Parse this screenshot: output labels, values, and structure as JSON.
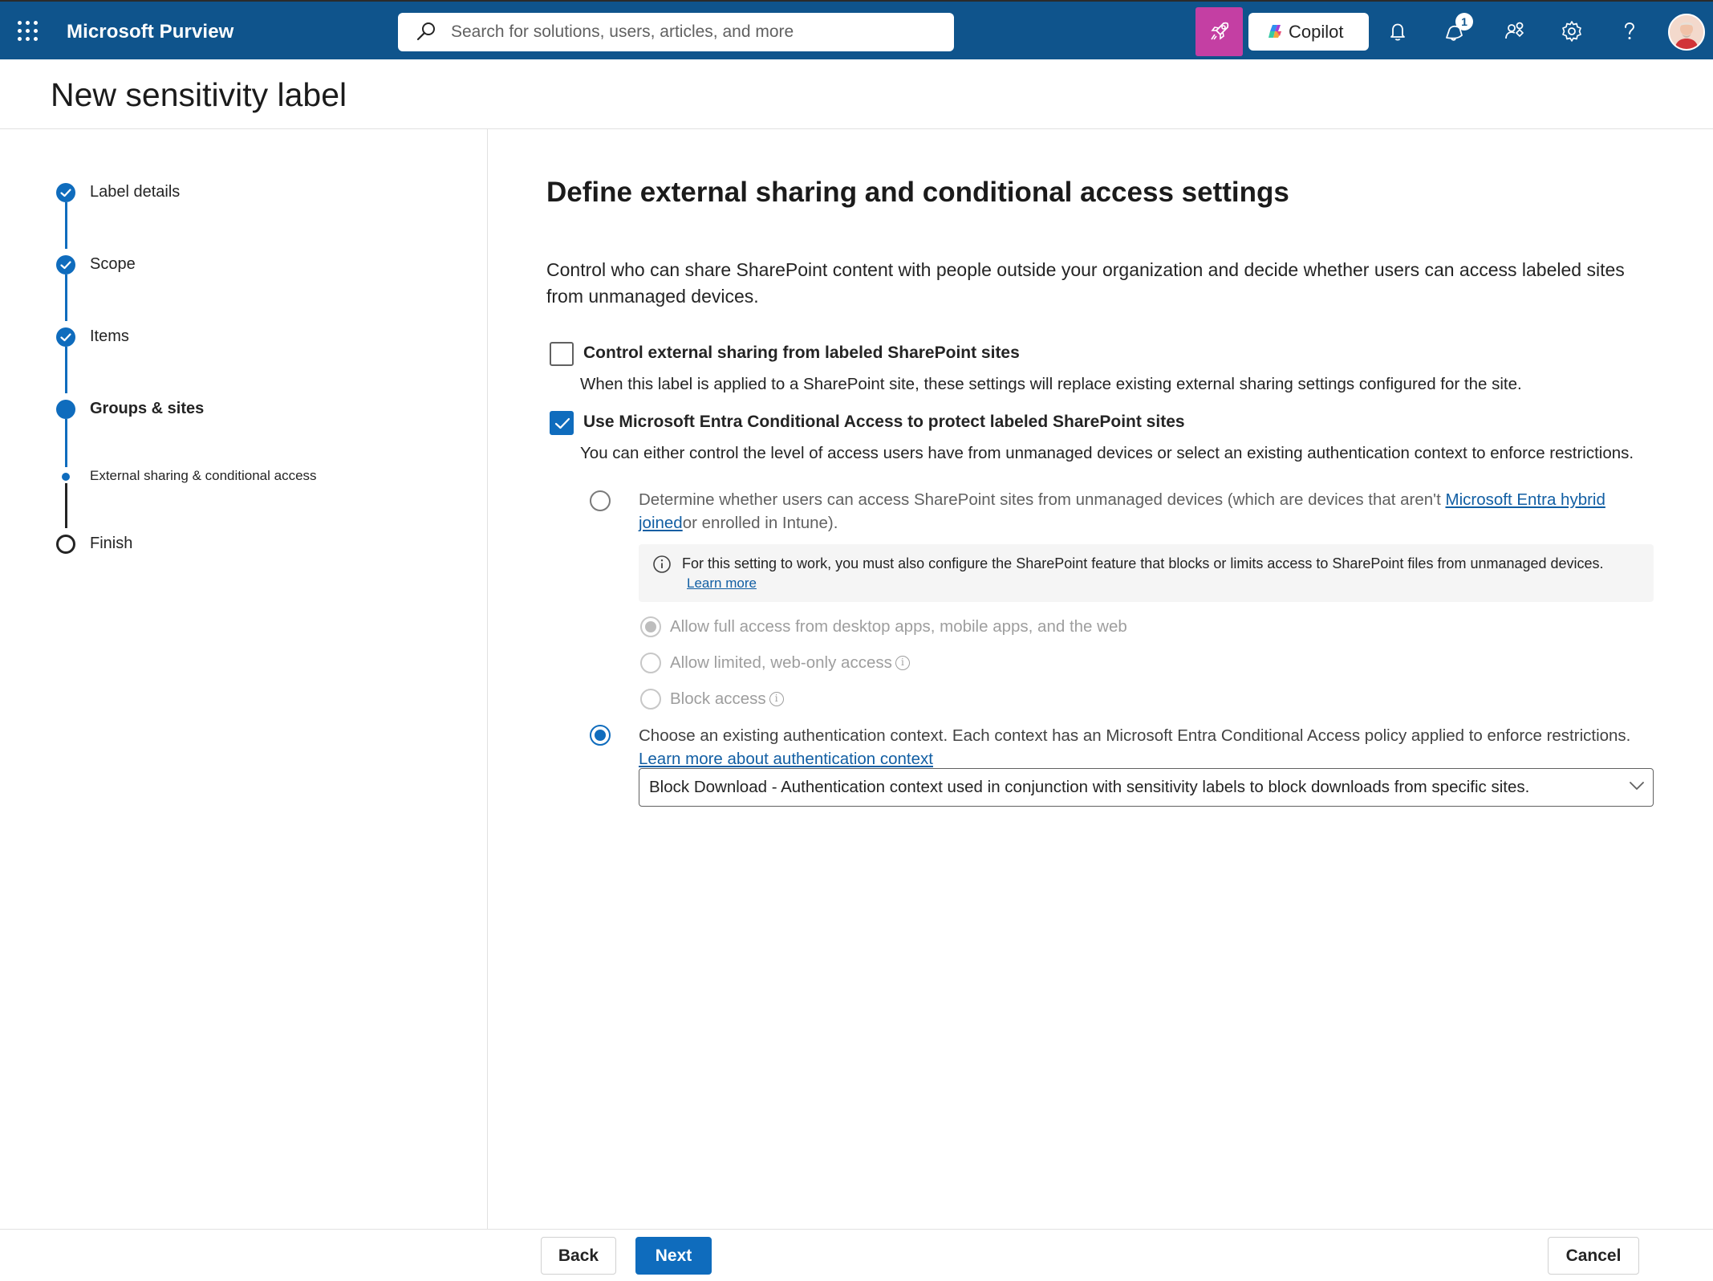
{
  "topbar": {
    "app_name": "Microsoft Purview",
    "search_placeholder": "Search for solutions, users, articles, and more",
    "copilot_label": "Copilot",
    "notification_count": "1"
  },
  "page": {
    "title": "New sensitivity label"
  },
  "stepper": {
    "steps": [
      {
        "label": "Label details",
        "state": "done"
      },
      {
        "label": "Scope",
        "state": "done"
      },
      {
        "label": "Items",
        "state": "done"
      },
      {
        "label": "Groups & sites",
        "state": "current"
      },
      {
        "label": "External sharing & conditional access",
        "state": "current-substep"
      },
      {
        "label": "Finish",
        "state": "todo"
      }
    ]
  },
  "main": {
    "heading": "Define external sharing and conditional access settings",
    "intro": "Control who can share SharePoint content with people outside your organization and decide whether users can access labeled sites from unmanaged devices.",
    "external_sharing": {
      "label": "Control external sharing from labeled SharePoint sites",
      "description": "When this label is applied to a SharePoint site, these settings will replace existing external sharing settings configured for the site.",
      "checked": false
    },
    "conditional_access": {
      "label": "Use Microsoft Entra Conditional Access to protect labeled SharePoint sites",
      "description": "You can either control the level of access users have from unmanaged devices or select an existing authentication context to enforce restrictions.",
      "checked": true
    },
    "option_unmanaged": {
      "text_before": "Determine whether users can access SharePoint sites from unmanaged devices (which are devices that aren't ",
      "link": "Microsoft Entra hybrid joined",
      "text_after": "or enrolled in Intune).",
      "info_text": "For this setting to work, you must also configure the SharePoint feature that blocks or limits access to SharePoint files from unmanaged devices.",
      "info_link": "Learn more",
      "sub_options": [
        "Allow full access from desktop apps, mobile apps, and the web",
        "Allow limited, web-only access",
        "Block access"
      ]
    },
    "option_auth_context": {
      "text": "Choose an existing authentication context. Each context has an Microsoft Entra Conditional Access policy applied to enforce restrictions.",
      "link": "Learn more about authentication context",
      "selected_value": "Block Download - Authentication context used in conjunction with sensitivity labels to block downloads from specific sites."
    }
  },
  "footer": {
    "back": "Back",
    "next": "Next",
    "cancel": "Cancel"
  },
  "colors": {
    "topbar": "#0f548c",
    "accent": "#0f6cbd",
    "mascot": "#c43fa3"
  }
}
